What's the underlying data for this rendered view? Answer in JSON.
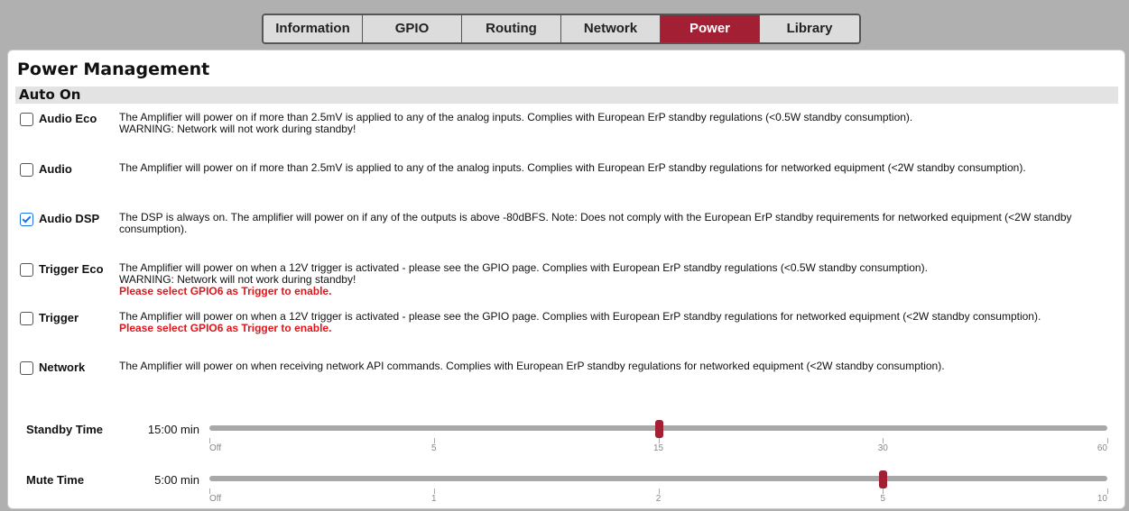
{
  "tabs": [
    {
      "label": "Information",
      "active": false
    },
    {
      "label": "GPIO",
      "active": false
    },
    {
      "label": "Routing",
      "active": false
    },
    {
      "label": "Network",
      "active": false
    },
    {
      "label": "Power",
      "active": true
    },
    {
      "label": "Library",
      "active": false
    }
  ],
  "page": {
    "title": "Power Management",
    "section": "Auto On"
  },
  "options": [
    {
      "label": "Audio Eco",
      "checked": false,
      "desc": "The Amplifier will power on if more than 2.5mV is applied to any of the analog inputs. Complies with European ErP standby regulations (<0.5W standby consumption).",
      "desc2": "WARNING: Network will not work during standby!",
      "warning": ""
    },
    {
      "label": "Audio",
      "checked": false,
      "desc": "The Amplifier will power on if more than 2.5mV is applied to any of the analog inputs. Complies with European ErP standby regulations for networked equipment (<2W standby consumption).",
      "desc2": "",
      "warning": ""
    },
    {
      "label": "Audio DSP",
      "checked": true,
      "desc": "The DSP is always on. The amplifier will power on if any of the outputs is above -80dBFS. Note: Does not comply with the European ErP standby requirements for networked equipment (<2W standby consumption).",
      "desc2": "",
      "warning": ""
    },
    {
      "label": "Trigger Eco",
      "checked": false,
      "desc": "The Amplifier will power on when a 12V trigger is activated - please see the GPIO page. Complies with European ErP standby regulations (<0.5W standby consumption).",
      "desc2": "WARNING: Network will not work during standby!",
      "warning": "Please select GPIO6 as Trigger to enable."
    },
    {
      "label": "Trigger",
      "checked": false,
      "desc": "The Amplifier will power on when a 12V trigger is activated - please see the GPIO page. Complies with European ErP standby regulations for networked equipment (<2W standby consumption).",
      "desc2": "",
      "warning": "Please select GPIO6 as Trigger to enable."
    },
    {
      "label": "Network",
      "checked": false,
      "desc": "The Amplifier will power on when receiving network API commands. Complies with European ErP standby regulations for networked equipment (<2W standby consumption).",
      "desc2": "",
      "warning": ""
    }
  ],
  "sliders": [
    {
      "label": "Standby Time",
      "value_text": "15:00 min",
      "ticks": [
        "Off",
        "5",
        "15",
        "30",
        "60"
      ],
      "position_tick_index": 2
    },
    {
      "label": "Mute Time",
      "value_text": "5:00 min",
      "ticks": [
        "Off",
        "1",
        "2",
        "5",
        "10"
      ],
      "position_tick_index": 3
    }
  ]
}
